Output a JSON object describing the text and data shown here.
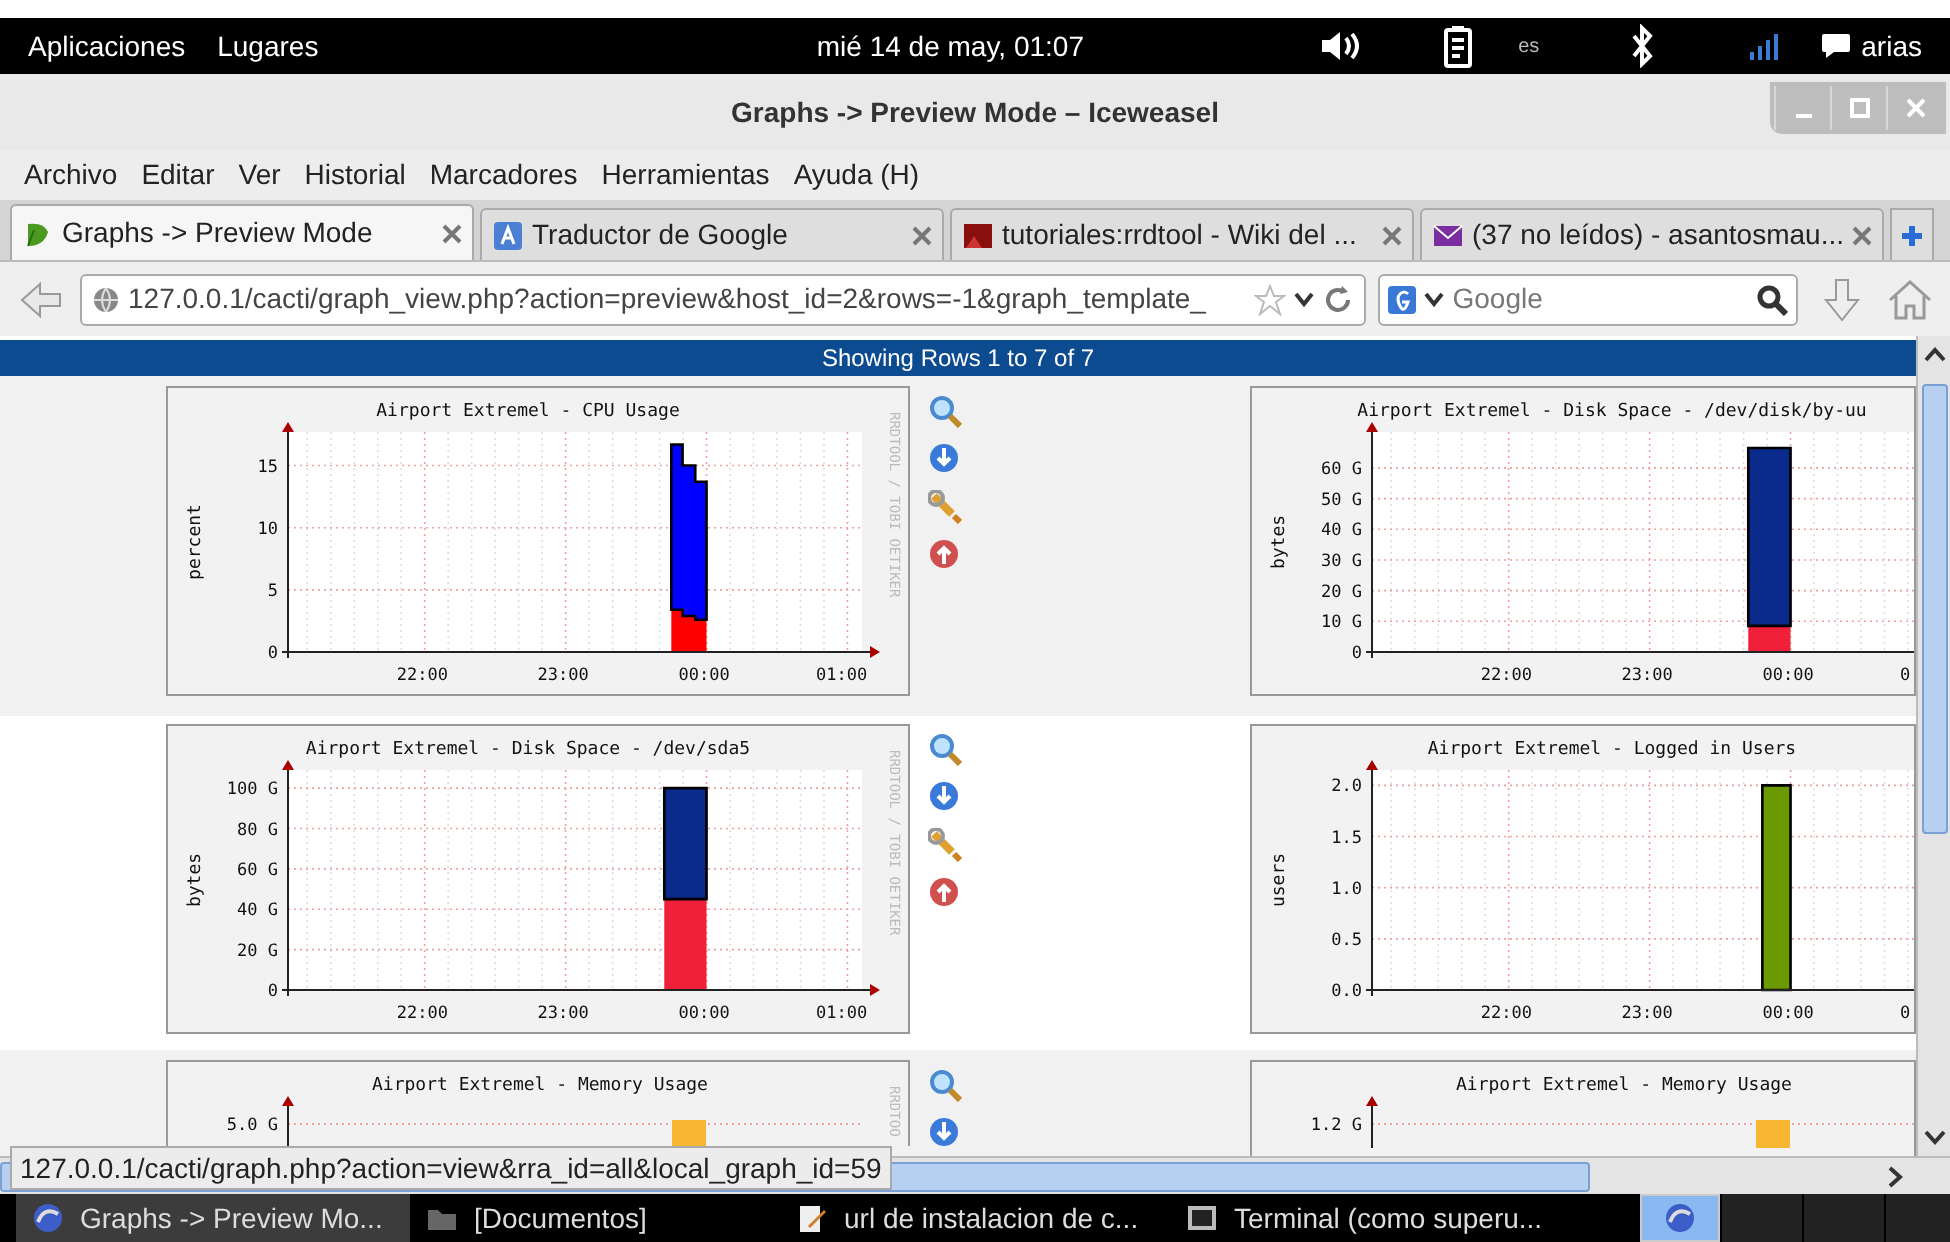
{
  "top_panel": {
    "menus": [
      "Aplicaciones",
      "Lugares"
    ],
    "clock": "mié 14 de may, 01:07",
    "keyboard_layout": "es",
    "user": "arias"
  },
  "window": {
    "title": "Graphs -> Preview Mode – Iceweasel"
  },
  "menu_bar": [
    "Archivo",
    "Editar",
    "Ver",
    "Historial",
    "Marcadores",
    "Herramientas",
    "Ayuda (H)"
  ],
  "tabs": [
    {
      "label": "Graphs -> Preview Mode",
      "kind": "leaf",
      "selected": true
    },
    {
      "label": "Traductor de Google",
      "kind": "translate",
      "selected": false
    },
    {
      "label": "tutoriales:rrdtool - Wiki del ...",
      "kind": "square",
      "selected": false
    },
    {
      "label": "(37 no leídos) - asantosmau...",
      "kind": "mail",
      "selected": false
    }
  ],
  "address_bar": {
    "url": "127.0.0.1/cacti/graph_view.php?action=preview&host_id=2&rows=-1&graph_template_"
  },
  "search": {
    "placeholder": "Google"
  },
  "banner": "Showing Rows 1 to 7 of 7",
  "graphs": [
    {
      "kind": "chart",
      "watermark": "RRDTOOL / TOBI OETIKER",
      "last_tick_label": "01:00",
      "actions": [
        {
          "kind": "zoom"
        },
        {
          "kind": "download"
        },
        {
          "kind": "edit"
        },
        {
          "kind": "delete"
        }
      ],
      "chart_data": {
        "type": "area",
        "title": "Airport Extremel - CPU Usage",
        "ylabel": "percent",
        "stacked": true,
        "grid": true,
        "xlim": [
          21.03,
          25.16
        ],
        "ylim": [
          0,
          17.7
        ],
        "xticks": [
          {
            "value": 22,
            "label": "22:00"
          },
          {
            "value": 23,
            "label": "23:00"
          },
          {
            "value": 24,
            "label": "00:00"
          }
        ],
        "yticks": [
          0,
          5,
          10,
          15
        ],
        "x": [
          23.75,
          23.83,
          23.92,
          24.0
        ],
        "series": [
          {
            "color": "#ff0000",
            "values": [
              3.4,
              2.9,
              2.6,
              2.6
            ]
          },
          {
            "color": "#0000ff",
            "values": [
              13.3,
              12.1,
              11.1,
              11.1
            ]
          }
        ]
      }
    },
    {
      "kind": "chart",
      "last_tick_label": "0",
      "chart_data": {
        "type": "area",
        "title": "Airport Extremel - Disk Space - /dev/disk/by-uu",
        "ylabel": "bytes",
        "stacked": true,
        "grid": true,
        "xlim": [
          21.03,
          25.16
        ],
        "ylim": [
          0,
          71.7
        ],
        "xticks": [
          {
            "value": 22,
            "label": "22:00"
          },
          {
            "value": 23,
            "label": "23:00"
          },
          {
            "value": 24,
            "label": "00:00"
          }
        ],
        "yticks": [
          {
            "value": 0,
            "label": "0"
          },
          {
            "value": 10,
            "label": "10 G"
          },
          {
            "value": 20,
            "label": "20 G"
          },
          {
            "value": 30,
            "label": "30 G"
          },
          {
            "value": 40,
            "label": "40 G"
          },
          {
            "value": 50,
            "label": "50 G"
          },
          {
            "value": 60,
            "label": "60 G"
          }
        ],
        "x": [
          23.7,
          24.0
        ],
        "series": [
          {
            "color": "#f0203a",
            "values": [
              8.5,
              8.5
            ]
          },
          {
            "color": "#0a2a8c",
            "values": [
              58,
              58
            ]
          }
        ]
      }
    },
    {
      "kind": "chart",
      "watermark": "RRDTOOL / TOBI OETIKER",
      "last_tick_label": "01:00",
      "actions": [
        {
          "kind": "zoom"
        },
        {
          "kind": "download"
        },
        {
          "kind": "edit"
        },
        {
          "kind": "delete"
        }
      ],
      "chart_data": {
        "type": "area",
        "title": "Airport Extremel - Disk Space - /dev/sda5",
        "ylabel": "bytes",
        "stacked": true,
        "grid": true,
        "xlim": [
          21.03,
          25.16
        ],
        "ylim": [
          0,
          109
        ],
        "xticks": [
          {
            "value": 22,
            "label": "22:00"
          },
          {
            "value": 23,
            "label": "23:00"
          },
          {
            "value": 24,
            "label": "00:00"
          }
        ],
        "yticks": [
          {
            "value": 0,
            "label": "0"
          },
          {
            "value": 20,
            "label": "20 G"
          },
          {
            "value": 40,
            "label": "40 G"
          },
          {
            "value": 60,
            "label": "60 G"
          },
          {
            "value": 80,
            "label": "80 G"
          },
          {
            "value": 100,
            "label": "100 G"
          }
        ],
        "x": [
          23.7,
          24.0
        ],
        "series": [
          {
            "color": "#f0203a",
            "values": [
              45,
              45
            ]
          },
          {
            "color": "#0a2a8c",
            "values": [
              55,
              55
            ]
          }
        ]
      }
    },
    {
      "kind": "chart",
      "last_tick_label": "0",
      "chart_data": {
        "type": "area",
        "title": "Airport Extremel - Logged in Users",
        "ylabel": "users",
        "stacked": true,
        "grid": true,
        "xlim": [
          21.03,
          25.16
        ],
        "ylim": [
          0,
          2.15
        ],
        "xticks": [
          {
            "value": 22,
            "label": "22:00"
          },
          {
            "value": 23,
            "label": "23:00"
          },
          {
            "value": 24,
            "label": "00:00"
          }
        ],
        "yticks": [
          {
            "value": 0,
            "label": "0.0"
          },
          {
            "value": 0.5,
            "label": "0.5"
          },
          {
            "value": 1,
            "label": "1.0"
          },
          {
            "value": 1.5,
            "label": "1.5"
          },
          {
            "value": 2,
            "label": "2.0"
          }
        ],
        "x": [
          23.8,
          24.0
        ],
        "series": [
          {
            "color": "#6a9a00",
            "values": [
              2,
              2
            ]
          }
        ]
      }
    },
    {
      "kind": "partial",
      "title": "Airport Extremel - Memory Usage",
      "top_tick": "5.0 G",
      "watermark": "RRDTOO",
      "actions": [
        {
          "kind": "zoom"
        },
        {
          "kind": "download"
        }
      ]
    },
    {
      "kind": "partial",
      "title": "Airport Extremel - Memory Usage",
      "top_tick": "1.2 G"
    }
  ],
  "status_link": "127.0.0.1/cacti/graph.php?action=view&rra_id=all&local_graph_id=59",
  "taskbar": [
    {
      "label": "Graphs -> Preview Mo...",
      "kind": "browser",
      "selected": true
    },
    {
      "label": "[Documentos]",
      "kind": "folder",
      "selected": false
    },
    {
      "label": "url de instalacion de c...",
      "kind": "editor",
      "selected": false
    },
    {
      "label": "Terminal (como superu...",
      "kind": "terminal",
      "selected": false
    }
  ]
}
